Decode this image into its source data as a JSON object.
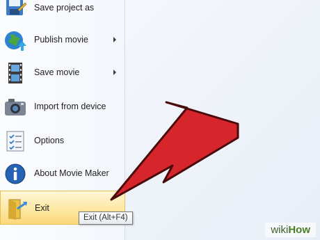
{
  "menu": {
    "items": [
      {
        "label": "Save project as",
        "icon": "save-as-icon",
        "submenu": false
      },
      {
        "label": "Publish movie",
        "icon": "globe-publish-icon",
        "submenu": true
      },
      {
        "label": "Save movie",
        "icon": "film-strip-icon",
        "submenu": true
      },
      {
        "label": "Import from device",
        "icon": "camera-icon",
        "submenu": false
      },
      {
        "label": "Options",
        "icon": "checklist-icon",
        "submenu": false
      },
      {
        "label": "About Movie Maker",
        "icon": "info-icon",
        "submenu": false
      },
      {
        "label": "Exit",
        "icon": "exit-door-icon",
        "submenu": false,
        "highlighted": true
      }
    ]
  },
  "tooltip": "Exit (Alt+F4)",
  "watermark": {
    "prefix": "wiki",
    "suffix": "How"
  },
  "colors": {
    "arrow": "#d6262b",
    "highlight": "#fde7a3",
    "accent": "#2f7fcf"
  }
}
